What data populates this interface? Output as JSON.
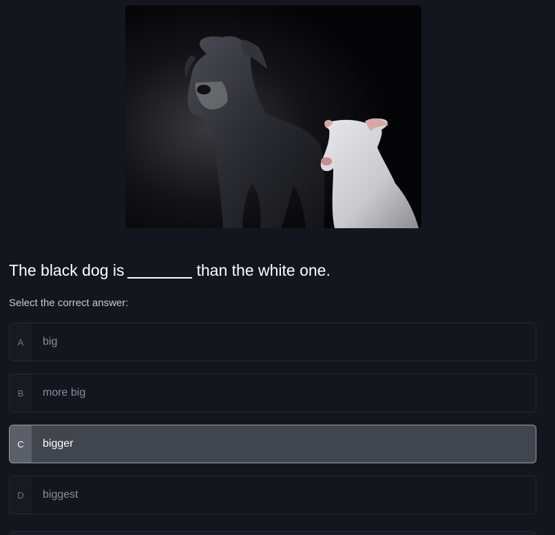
{
  "question": {
    "before_blank": "The black dog is",
    "after_blank": "than the white one."
  },
  "prompt": "Select the correct answer:",
  "options": [
    {
      "letter": "A",
      "text": "big",
      "selected": false
    },
    {
      "letter": "B",
      "text": "more big",
      "selected": false
    },
    {
      "letter": "C",
      "text": "bigger",
      "selected": true
    },
    {
      "letter": "D",
      "text": "biggest",
      "selected": false
    }
  ],
  "colors": {
    "background": "#13161d",
    "selected_option": "#40454e",
    "selected_border": "#9aa0aa",
    "option_border": "#262a33"
  }
}
